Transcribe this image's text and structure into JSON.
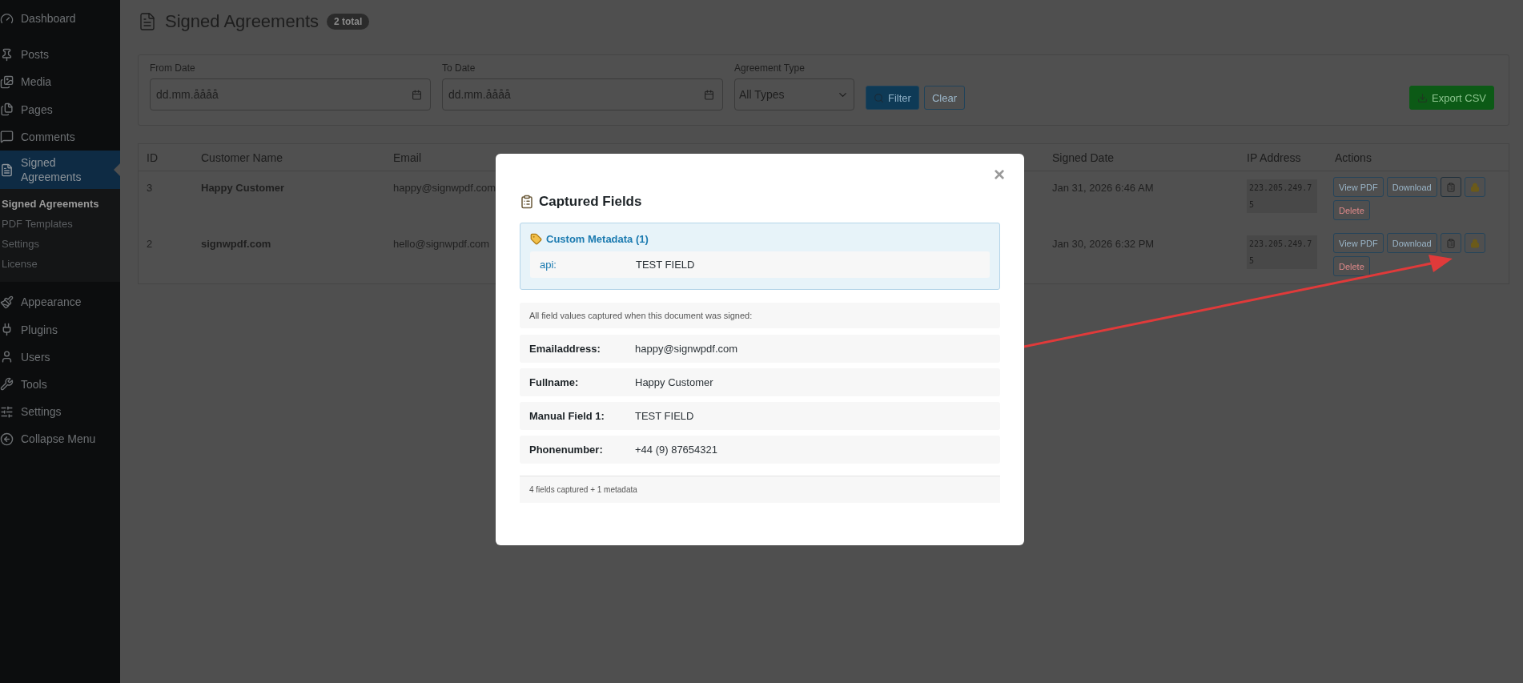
{
  "sidebar": {
    "items": [
      {
        "label": "Dashboard",
        "selected": false
      },
      {
        "label": "Posts",
        "selected": false
      },
      {
        "label": "Media",
        "selected": false
      },
      {
        "label": "Pages",
        "selected": false
      },
      {
        "label": "Comments",
        "selected": false
      },
      {
        "label": "Signed Agreements",
        "selected": true,
        "children": [
          {
            "label": "Signed Agreements",
            "selected": true
          },
          {
            "label": "PDF Templates",
            "selected": false
          },
          {
            "label": "Settings",
            "selected": false
          },
          {
            "label": "License",
            "selected": false
          }
        ]
      },
      {
        "label": "Appearance",
        "selected": false
      },
      {
        "label": "Plugins",
        "selected": false
      },
      {
        "label": "Users",
        "selected": false
      },
      {
        "label": "Tools",
        "selected": false
      },
      {
        "label": "Settings",
        "selected": false
      }
    ],
    "collapse": "Collapse Menu"
  },
  "page": {
    "title": "Signed Agreements",
    "count": "2 total"
  },
  "filters": {
    "from": {
      "label": "From Date",
      "placeholder": "dd.mm.åååå"
    },
    "to": {
      "label": "To Date",
      "placeholder": "dd.mm.åååå"
    },
    "type": {
      "label": "Agreement Type",
      "value": "All Types"
    },
    "filter_button": "Filter",
    "clear_button": "Clear",
    "export_button": "Export CSV"
  },
  "table": {
    "columns": [
      "ID",
      "Customer Name",
      "Email",
      "Signed Date",
      "IP Address",
      "Actions"
    ],
    "rows": [
      {
        "id": "3",
        "name": "Happy Customer",
        "email": "happy@signwpdf.com",
        "signed": "Jan 31, 2026 6:46 AM",
        "ip": "223.205.249.75",
        "view": "View PDF",
        "download": "Download",
        "delete": "Delete"
      },
      {
        "id": "2",
        "name": "signwpdf.com",
        "email": "hello@signwpdf.com",
        "signed": "Jan 30, 2026 6:32 PM",
        "ip": "223.205.249.75",
        "view": "View PDF",
        "download": "Download",
        "delete": "Delete"
      }
    ]
  },
  "modal": {
    "close": "×",
    "title": "Captured Fields",
    "metadata": {
      "title": "Custom Metadata (1)",
      "rows": [
        {
          "key": "api:",
          "value": "TEST FIELD"
        }
      ]
    },
    "intro": "All field values captured when this document was signed:",
    "fields": [
      {
        "label": "Emailaddress:",
        "value": "happy@signwpdf.com"
      },
      {
        "label": "Fullname:",
        "value": "Happy Customer"
      },
      {
        "label": "Manual Field 1:",
        "value": "TEST FIELD"
      },
      {
        "label": "Phonenumber:",
        "value": "+44 (9) 87654321"
      }
    ],
    "footer": "4 fields captured + 1 metadata"
  }
}
